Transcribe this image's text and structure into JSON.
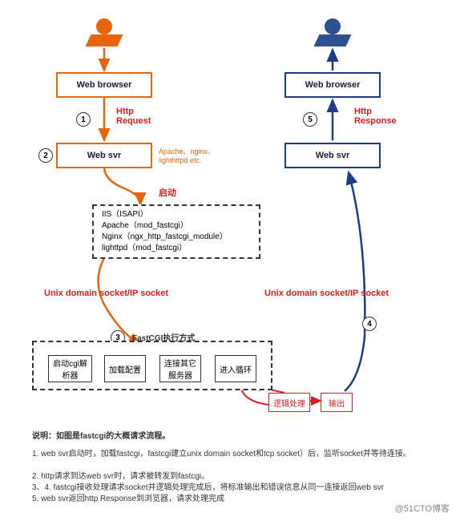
{
  "left": {
    "user": "user-icon",
    "browser": "Web browser",
    "svr": "Web svr",
    "req": "Http\nRequest",
    "svrnote": "Apache、nginx、\nlighthttpd etc.",
    "startup": "启动",
    "modules": "IIS（ISAPI）\nApache（mod_fastcgi）\nNginx（ngx_http_fastcgi_module）\nlighttpd（mod_fastcgi）"
  },
  "right": {
    "user": "user-icon",
    "browser": "Web browser",
    "svr": "Web svr",
    "resp": "Http\nResponse"
  },
  "sock": "Unix domain socket/IP socket",
  "fastcgi": {
    "title": "FastCGI执行方式",
    "b1": "启动cgi解析器",
    "b2": "加载配置",
    "b3": "连接其它服务器",
    "b4": "进入循环",
    "b5": "逻辑处理",
    "b6": "输出"
  },
  "nums": {
    "n1": "1",
    "n2": "2",
    "n3": "3",
    "n4": "4",
    "n5": "5"
  },
  "note": "说明：如图是fastcgi的大概请求流程。",
  "foot1": "1. web svr启动时，加载fastcgi，fastcgi建立unix domain socket和tcp socket）后，监听socket并等待连接。",
  "foot2": "2. http请求到达web svr时，请求被转发到fastcgi。",
  "foot3": "3、4. fastcgi接收处理请求socket并逻辑处理完成后，将标准输出和错误信息从同一连接返回web svr",
  "foot4": "5. web svr返回http Response到浏览器，请求处理完成",
  "watermark": "@51CTO博客"
}
